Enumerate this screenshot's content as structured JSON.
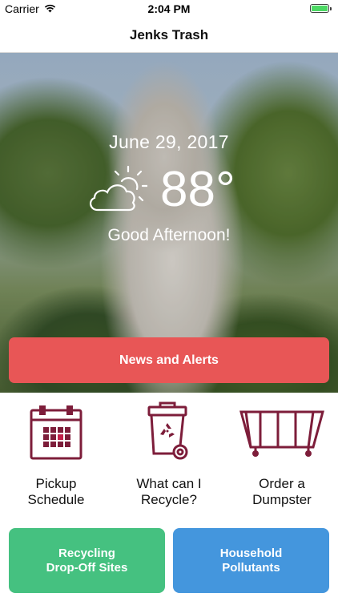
{
  "status_bar": {
    "carrier": "Carrier",
    "time": "2:04 PM",
    "battery_color": "#4cd964"
  },
  "nav": {
    "title": "Jenks Trash"
  },
  "hero": {
    "date": "June 29, 2017",
    "temperature": "88°",
    "greeting": "Good Afternoon!",
    "weather_icon": "partly-cloudy-icon"
  },
  "news_button": {
    "label": "News and Alerts",
    "color": "#e85656"
  },
  "tiles": [
    {
      "label": "Pickup\nSchedule",
      "icon": "calendar-icon"
    },
    {
      "label": "What can I\nRecycle?",
      "icon": "recycle-bin-icon"
    },
    {
      "label": "Order a\nDumpster",
      "icon": "dumpster-icon"
    }
  ],
  "bottom_buttons": {
    "recycling": {
      "label": "Recycling\nDrop-Off Sites",
      "color": "#45c180"
    },
    "pollutants": {
      "label": "Household\nPollutants",
      "color": "#4496dd"
    }
  },
  "theme": {
    "icon_color": "#7d1d3a"
  }
}
